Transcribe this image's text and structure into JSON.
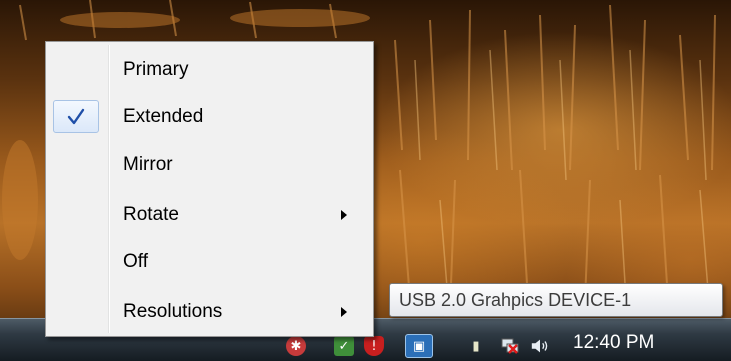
{
  "context_menu": {
    "items": [
      {
        "label": "Primary",
        "checked": false,
        "submenu": false
      },
      {
        "label": "Extended",
        "checked": true,
        "submenu": false
      },
      {
        "label": "Mirror",
        "checked": false,
        "submenu": false
      },
      {
        "label": "Rotate",
        "checked": false,
        "submenu": true
      },
      {
        "label": "Off",
        "checked": false,
        "submenu": false
      },
      {
        "label": "Resolutions",
        "checked": false,
        "submenu": true
      }
    ]
  },
  "tooltip": {
    "text": "USB 2.0 Grahpics DEVICE-1"
  },
  "tray": {
    "clock": "12:40 PM",
    "icons": [
      "network-alert-icon",
      "security-center-icon",
      "shield-alert-icon",
      "usb-display-icon",
      "power-icon",
      "network-disconnected-icon",
      "volume-icon"
    ]
  },
  "colors": {
    "check_mark": "#1f4fa8",
    "check_highlight": "#dbe8f9",
    "menu_bg": "#f1f1f1"
  }
}
